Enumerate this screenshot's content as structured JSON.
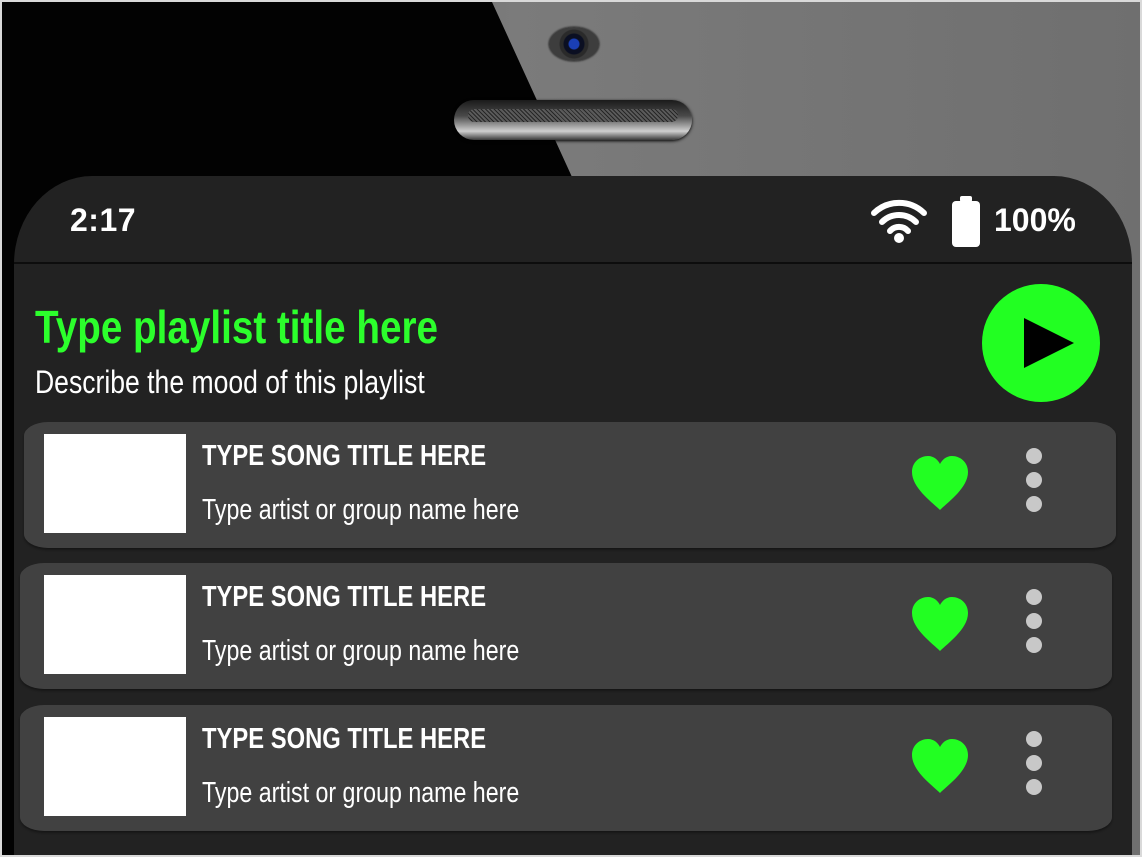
{
  "status_bar": {
    "time": "2:17",
    "battery_percent": "100%",
    "wifi_icon": "wifi-icon",
    "battery_icon": "battery-full-icon"
  },
  "playlist": {
    "title": "Type playlist title here",
    "description": "Describe the mood of this playlist",
    "play_icon": "play-icon",
    "accent_color": "#22ff22"
  },
  "songs": [
    {
      "title": "TYPE SONG TITLE HERE",
      "artist": "Type artist or group name here",
      "liked": true
    },
    {
      "title": "TYPE SONG TITLE HERE",
      "artist": "Type artist or group name here",
      "liked": true
    },
    {
      "title": "TYPE SONG TITLE HERE",
      "artist": "Type artist or group name here",
      "liked": true
    }
  ],
  "icons": {
    "like": "heart-icon",
    "more": "more-vertical-icon"
  },
  "colors": {
    "screen_background": "#222222",
    "row_background": "#414141",
    "accent": "#22ff22",
    "text": "#ffffff"
  }
}
